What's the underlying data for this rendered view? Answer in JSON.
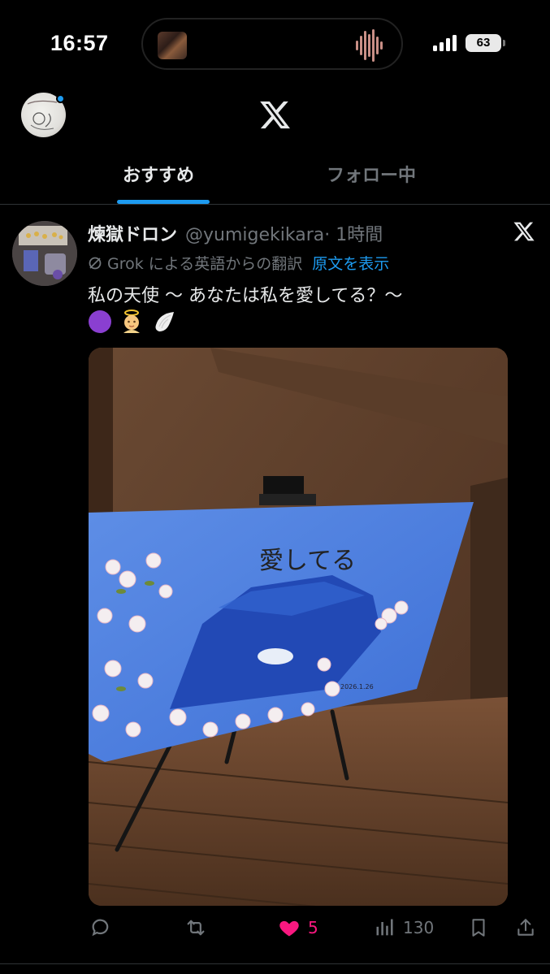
{
  "status_bar": {
    "time": "16:57",
    "battery": "63"
  },
  "header": {
    "tabs": [
      {
        "label": "おすすめ",
        "selected": true
      },
      {
        "label": "フォロー中",
        "selected": false
      }
    ]
  },
  "post": {
    "author_name": "煉獄ドロン",
    "author_handle": "@yumigekikara",
    "time": "· 1時間",
    "translation_note": "Grok による英語からの翻訳",
    "show_original": "原文を表示",
    "text": "私の天使 〜 あなたは私を愛してる？〜",
    "emojis": [
      "purple-circle",
      "baby-angel",
      "wing"
    ],
    "painting_text": "愛してる",
    "signature_date": "2026.1.26",
    "actions": {
      "likes": "5",
      "views": "130",
      "liked": true
    }
  },
  "colors": {
    "accent": "#1d9bf0",
    "like": "#f91880",
    "muted": "#71767b"
  }
}
